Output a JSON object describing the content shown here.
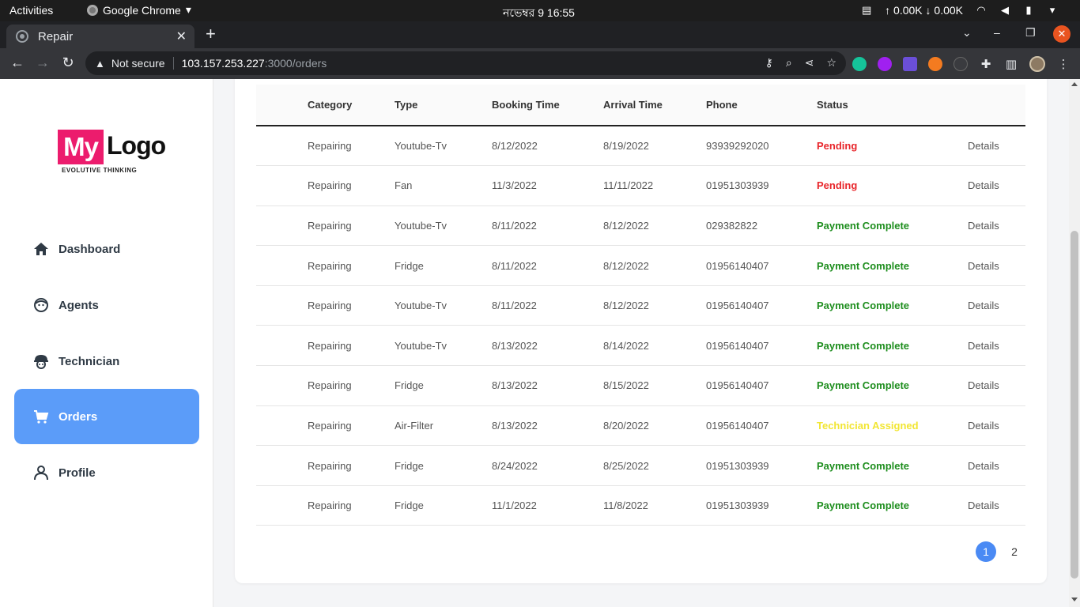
{
  "os": {
    "activities": "Activities",
    "app_name": "Google Chrome",
    "clock": "নভেম্বর 9  16:55",
    "net_speed": "↑ 0.00K ↓ 0.00K"
  },
  "browser": {
    "tab_title": "Repair",
    "security_text": "Not secure",
    "url_host": "103.157.253.227",
    "url_path": ":3000/orders"
  },
  "sidebar": {
    "logo": {
      "my": "My",
      "logo": "Logo",
      "tagline": "EVOLUTIVE THINKING"
    },
    "items": [
      {
        "label": "Dashboard",
        "icon": "home-icon"
      },
      {
        "label": "Agents",
        "icon": "agent-face-icon"
      },
      {
        "label": "Technician",
        "icon": "technician-helmet-icon"
      },
      {
        "label": "Orders",
        "icon": "cart-icon",
        "active": true
      },
      {
        "label": "Profile",
        "icon": "person-icon"
      }
    ]
  },
  "colors": {
    "accent": "#5b9cf9",
    "pending": "#e8262b",
    "complete": "#1e8e1e",
    "assigned": "#f2e633"
  },
  "table": {
    "headers": [
      "",
      "Category",
      "Type",
      "Booking Time",
      "Arrival Time",
      "Phone",
      "Status",
      ""
    ],
    "rows": [
      {
        "category": "Repairing",
        "type": "Youtube-Tv",
        "booking": "8/12/2022",
        "arrival": "8/19/2022",
        "phone": "93939292020",
        "status": "Pending",
        "status_kind": "pending",
        "action": "Details"
      },
      {
        "category": "Repairing",
        "type": "Fan",
        "booking": "11/3/2022",
        "arrival": "11/11/2022",
        "phone": "01951303939",
        "status": "Pending",
        "status_kind": "pending",
        "action": "Details"
      },
      {
        "category": "Repairing",
        "type": "Youtube-Tv",
        "booking": "8/11/2022",
        "arrival": "8/12/2022",
        "phone": "029382822",
        "status": "Payment Complete",
        "status_kind": "complete",
        "action": "Details"
      },
      {
        "category": "Repairing",
        "type": "Fridge",
        "booking": "8/11/2022",
        "arrival": "8/12/2022",
        "phone": "01956140407",
        "status": "Payment Complete",
        "status_kind": "complete",
        "action": "Details"
      },
      {
        "category": "Repairing",
        "type": "Youtube-Tv",
        "booking": "8/11/2022",
        "arrival": "8/12/2022",
        "phone": "01956140407",
        "status": "Payment Complete",
        "status_kind": "complete",
        "action": "Details"
      },
      {
        "category": "Repairing",
        "type": "Youtube-Tv",
        "booking": "8/13/2022",
        "arrival": "8/14/2022",
        "phone": "01956140407",
        "status": "Payment Complete",
        "status_kind": "complete",
        "action": "Details"
      },
      {
        "category": "Repairing",
        "type": "Fridge",
        "booking": "8/13/2022",
        "arrival": "8/15/2022",
        "phone": "01956140407",
        "status": "Payment Complete",
        "status_kind": "complete",
        "action": "Details"
      },
      {
        "category": "Repairing",
        "type": "Air-Filter",
        "booking": "8/13/2022",
        "arrival": "8/20/2022",
        "phone": "01956140407",
        "status": "Technician Assigned",
        "status_kind": "assigned",
        "action": "Details"
      },
      {
        "category": "Repairing",
        "type": "Fridge",
        "booking": "8/24/2022",
        "arrival": "8/25/2022",
        "phone": "01951303939",
        "status": "Payment Complete",
        "status_kind": "complete",
        "action": "Details"
      },
      {
        "category": "Repairing",
        "type": "Fridge",
        "booking": "11/1/2022",
        "arrival": "11/8/2022",
        "phone": "01951303939",
        "status": "Payment Complete",
        "status_kind": "complete",
        "action": "Details"
      }
    ]
  },
  "pagination": {
    "pages": [
      "1",
      "2"
    ],
    "current": "1"
  }
}
